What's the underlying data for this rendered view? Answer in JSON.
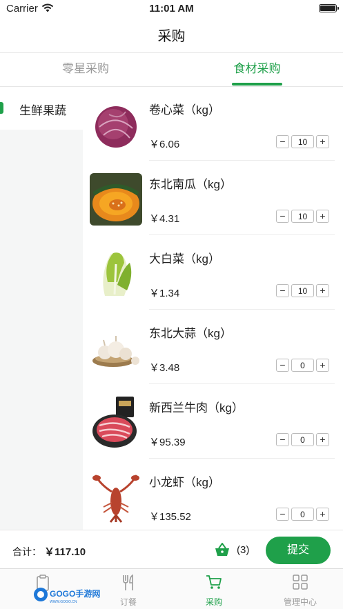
{
  "status_bar": {
    "carrier": "Carrier",
    "time": "11:01 AM"
  },
  "nav": {
    "title": "采购"
  },
  "tabs": [
    {
      "label": "零星采购",
      "active": false
    },
    {
      "label": "食材采购",
      "active": true
    }
  ],
  "sidebar": {
    "items": [
      {
        "label": "生鲜果蔬",
        "active": true
      }
    ]
  },
  "products": [
    {
      "name": "卷心菜（kg）",
      "price": "￥6.06",
      "quantity": "10",
      "image": "red-cabbage"
    },
    {
      "name": "东北南瓜（kg）",
      "price": "￥4.31",
      "quantity": "10",
      "image": "pumpkin"
    },
    {
      "name": "大白菜（kg）",
      "price": "￥1.34",
      "quantity": "10",
      "image": "chinese-cabbage"
    },
    {
      "name": "东北大蒜（kg）",
      "price": "￥3.48",
      "quantity": "0",
      "image": "garlic"
    },
    {
      "name": "新西兰牛肉（kg）",
      "price": "￥95.39",
      "quantity": "0",
      "image": "beef"
    },
    {
      "name": "小龙虾（kg）",
      "price": "￥135.52",
      "quantity": "0",
      "image": "crayfish"
    }
  ],
  "stepper": {
    "minus": "−",
    "plus": "+"
  },
  "footer": {
    "total_label": "合计：",
    "total_value": "￥117.10",
    "cart_count": "(3)",
    "submit_label": "提交"
  },
  "tabbar": [
    {
      "label": "",
      "icon": "clipboard-icon",
      "active": false
    },
    {
      "label": "订餐",
      "icon": "utensils-icon",
      "active": false
    },
    {
      "label": "采购",
      "icon": "cart-icon",
      "active": true
    },
    {
      "label": "管理中心",
      "icon": "grid-icon",
      "active": false
    }
  ],
  "watermark": {
    "text": "GOGO手游网",
    "sub": "WWW.GOGO.CN"
  },
  "colors": {
    "accent": "#1fa04a",
    "muted": "#999999",
    "sidebar_bg": "#f5f6f6"
  }
}
